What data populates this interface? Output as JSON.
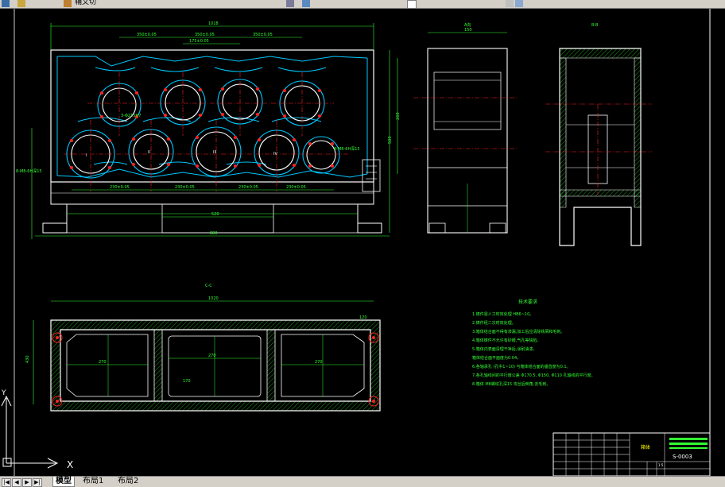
{
  "toolbar": {
    "partial_label": "辅文切",
    "colors": {
      "bg": "#d4d0c8"
    }
  },
  "drawing": {
    "sections": {
      "a_view": "A向",
      "b_view": "B-B",
      "c_section": "C-C",
      "title_label": "箱体"
    },
    "dimensions": {
      "top_overall": "1018",
      "top_a": "350±0.05",
      "top_b": "350±0.05",
      "top_c": "350±0.05",
      "top_center": "175±0.05",
      "bottom_a": "230±0.05",
      "bottom_b": "230±0.05",
      "bottom_c": "230±0.05",
      "bottom_d": "230±0.05",
      "base_total": "880",
      "base_mid": "520",
      "right_height": "500",
      "right_inner": "260",
      "side_width": "150",
      "c_total": "1020",
      "c_height": "430",
      "c_box1": "270",
      "c_box2": "270",
      "c_box3": "270",
      "c_box_h": "170",
      "c_right": "120"
    },
    "annotations": {
      "hole_callout": "3-Φ215H7",
      "hole_callout_2": "8-M8-6H深15",
      "left_note": "8-M8-6H深15",
      "bottom_note": "8-M8"
    }
  },
  "tech_requirements": {
    "title": "技术要求",
    "items": [
      "1.铸件需人工时效处理 HB6~10。",
      "2.铸件经二次时效处理。",
      "3.箱体结合面不得有渗漏,加工后应清除铁屑和毛刺。",
      "4.箱体铸件不允许有砂眼,气孔等缺陷。",
      "5.箱体内表面清理干净后,涂耐油漆。",
      "   箱体结合面平面度为0.04。",
      "6.各轴承孔 (孔中1~10) 与箱体结合面的垂直度为0.1。",
      "7.各孔轴线间的平行度公差 Φ170.5, Φ150, Φ110 孔轴线的平行度。",
      "8.箱体 M8螺纹孔深15 攻丝后倒角,去毛刺。"
    ]
  },
  "title_block": {
    "name": "箱体",
    "drawing_number": "S-0003"
  },
  "ucs": {
    "x_label": "X",
    "y_label": "Y"
  },
  "layout_tabs": {
    "model": "模型",
    "layout1": "布局1",
    "layout2": "布局2",
    "active": "model"
  },
  "colors": {
    "green": "#33ff33",
    "cyan": "#00c8ff",
    "white": "#ffffff",
    "red": "#ff2020",
    "yellow": "#ffff00",
    "background": "#000000"
  }
}
